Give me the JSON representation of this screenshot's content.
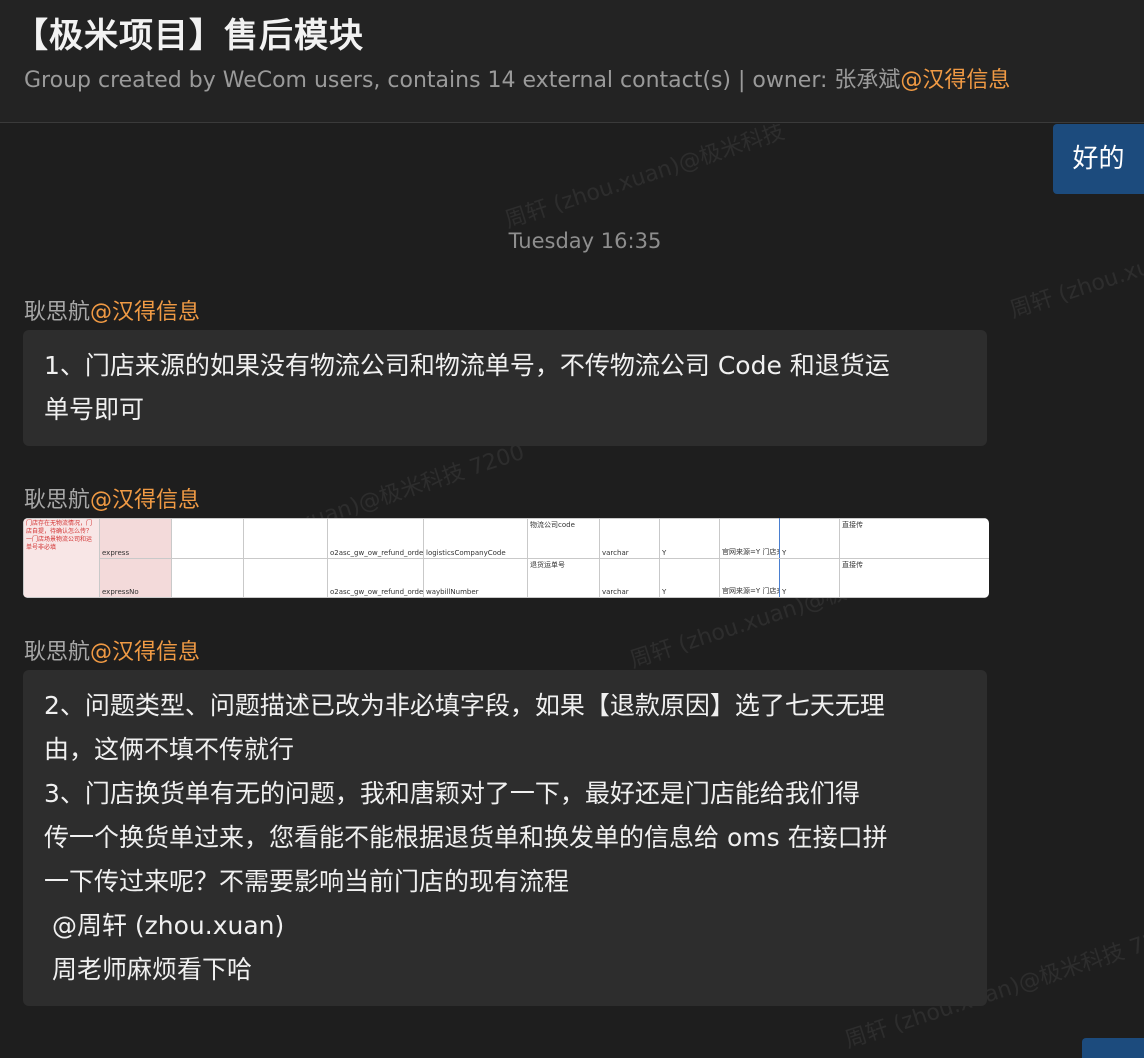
{
  "header": {
    "title": "【极米项目】售后模块",
    "subtitle_prefix": "Group created by WeCom users, contains 14 external contact(s) | owner: 张承斌",
    "subtitle_org": "@汉得信息"
  },
  "self_message": {
    "text": "好的"
  },
  "timestamp": "Tuesday 16:35",
  "messages": [
    {
      "sender": "耿思航",
      "org": "@汉得信息",
      "lines": [
        "1、门店来源的如果没有物流公司和物流单号，不传物流公司 Code 和退货运",
        "单号即可"
      ]
    },
    {
      "sender": "耿思航",
      "org": "@汉得信息",
      "image": {
        "note": "门店存在无物流情况，门店自提，待确认怎么传？一门店场景物流公司和运单号非必填",
        "rows": [
          {
            "field": "express",
            "table": "o2asc_gw_ow_refund_order",
            "column": "logisticsCompanyCode",
            "desc": "物流公司code",
            "type": "varchar",
            "required": "Y",
            "rule": "官网来源=Y 门店来源=N",
            "flag": "Y",
            "remark": "直接传"
          },
          {
            "field": "expressNo",
            "table": "o2asc_gw_ow_refund_order",
            "column": "waybillNumber",
            "desc": "退货运单号",
            "type": "varchar",
            "required": "Y",
            "rule": "官网来源=Y 门店来源=N",
            "flag": "Y",
            "remark": "直接传"
          }
        ]
      }
    },
    {
      "sender": "耿思航",
      "org": "@汉得信息",
      "lines": [
        "2、问题类型、问题描述已改为非必填字段，如果【退款原因】选了七天无理",
        "由，这俩不填不传就行",
        "3、门店换货单有无的问题，我和唐颖对了一下，最好还是门店能给我们得",
        "传一个换货单过来，您看能不能根据退货单和换发单的信息给 oms 在接口拼",
        "一下传过来呢？不需要影响当前门店的现有流程",
        " @周轩 (zhou.xuan)",
        " 周老师麻烦看下哈"
      ]
    }
  ],
  "watermarks": {
    "a": "周轩 (zhou.xuan)@极米科技",
    "b": "周轩 (zhou.xuan)@极米科技 7200",
    "c": "周轩 (zhou.xuan)@极米科技 7200",
    "d": "周轩 (zhou.xuan)@极米科技 7200",
    "e": "周轩 (zhou.xuan)@极米科技 7200"
  }
}
